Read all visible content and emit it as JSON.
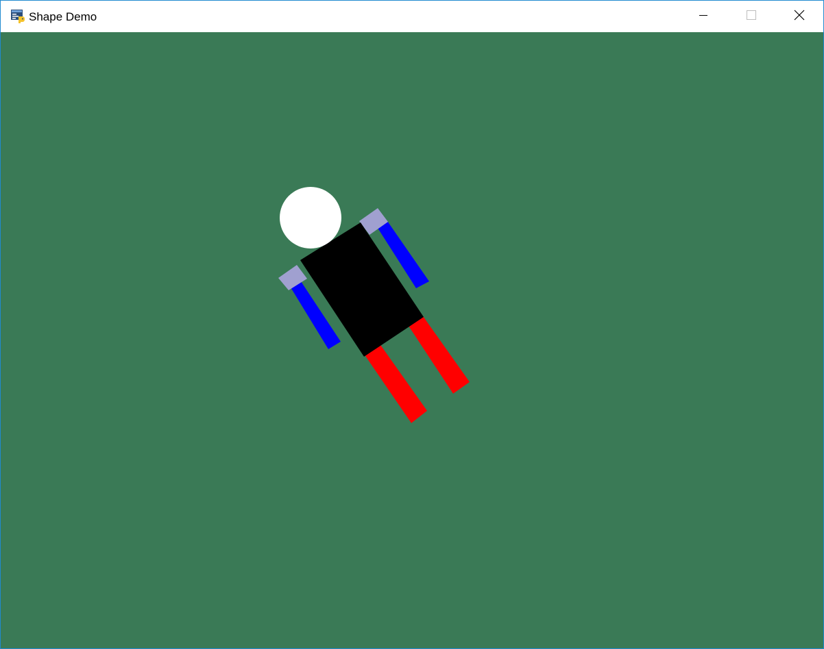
{
  "window": {
    "title": "Shape Demo",
    "icon": "python-icon"
  },
  "caption_buttons": {
    "minimize": "minimize-icon",
    "maximize": "maximize-icon",
    "close": "close-icon"
  },
  "scene": {
    "background_color": "#3a7a56",
    "figure": {
      "head_color": "#ffffff",
      "body_color": "#000000",
      "shoulder_color": "#a0a0d0",
      "arm_color": "#0000ff",
      "leg_color": "#ff0000"
    }
  }
}
